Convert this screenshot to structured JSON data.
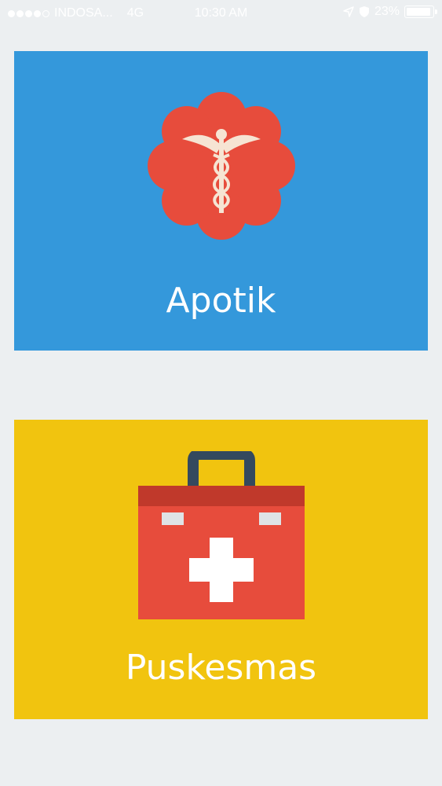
{
  "status_bar": {
    "carrier": "INDOSA...",
    "network": "4G",
    "time": "10:30 AM",
    "battery": "23%"
  },
  "tiles": [
    {
      "label": "Apotik",
      "color": "#3498db",
      "icon": "caduceus-flower-icon"
    },
    {
      "label": "Puskesmas",
      "color": "#f1c40f",
      "icon": "first-aid-kit-icon"
    }
  ],
  "colors": {
    "background": "#eceff1",
    "flower": "#e74c3c",
    "caduceus": "#f6e4d3",
    "kit_body": "#e74c3c",
    "kit_lid": "#c0392b",
    "kit_handle": "#34495e"
  }
}
